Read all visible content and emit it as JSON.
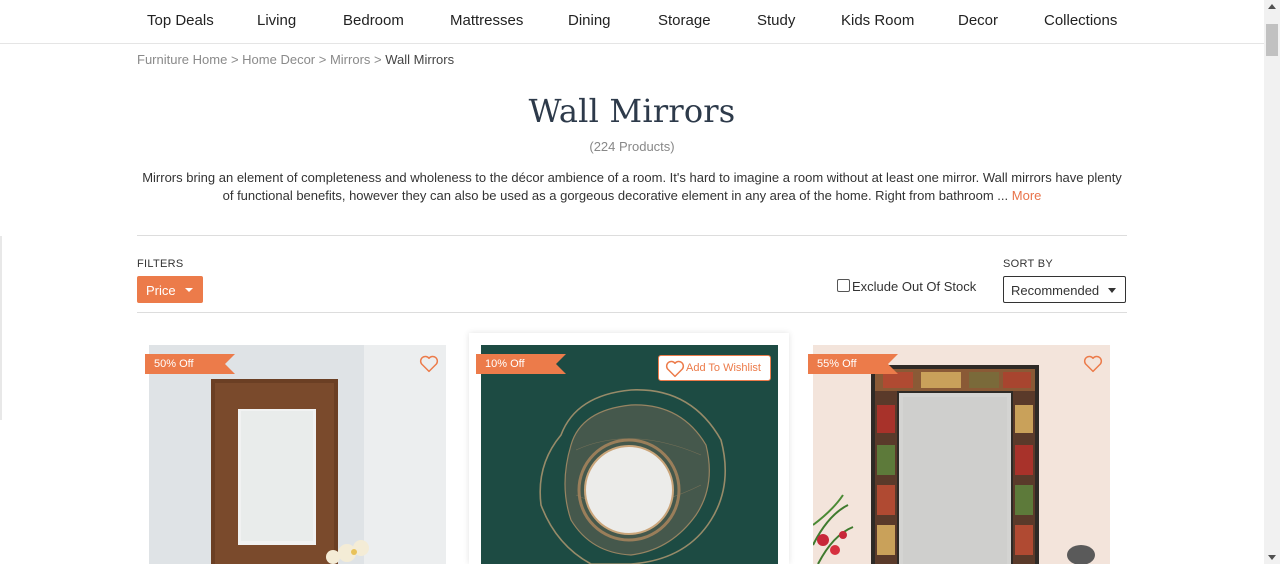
{
  "nav": {
    "items": [
      "Top Deals",
      "Living",
      "Bedroom",
      "Mattresses",
      "Dining",
      "Storage",
      "Study",
      "Kids Room",
      "Decor",
      "Collections"
    ]
  },
  "breadcrumb": {
    "items": [
      "Furniture Home",
      "Home Decor",
      "Mirrors"
    ],
    "separator": ">",
    "current": "Wall Mirrors"
  },
  "page": {
    "title": "Wall Mirrors",
    "count": "(224 Products)",
    "description": "Mirrors bring an element of completeness and wholeness to the décor ambience of a room. It's hard to imagine a room without at least one mirror. Wall mirrors have plenty of functional benefits, however they can also be used as a gorgeous decorative element in any area of the home. Right from bathroom ...",
    "more_link": "More"
  },
  "filters": {
    "label": "FILTERS",
    "price_label": "Price",
    "exclude_out_of_stock": "Exclude Out Of Stock",
    "exclude_checked": false
  },
  "sort": {
    "label": "SORT BY",
    "selected": "Recommended"
  },
  "products": [
    {
      "discount": "50% Off",
      "image": "wooden-frame-mirror"
    },
    {
      "discount": "10% Off",
      "image": "round-wire-mirror",
      "wishlist_label": "Add To Wishlist"
    },
    {
      "discount": "55% Off",
      "image": "painted-frame-mirror"
    }
  ],
  "colors": {
    "accent": "#ec7b4a",
    "title": "#2d3a4a",
    "teal_background": "#1d4b43"
  }
}
